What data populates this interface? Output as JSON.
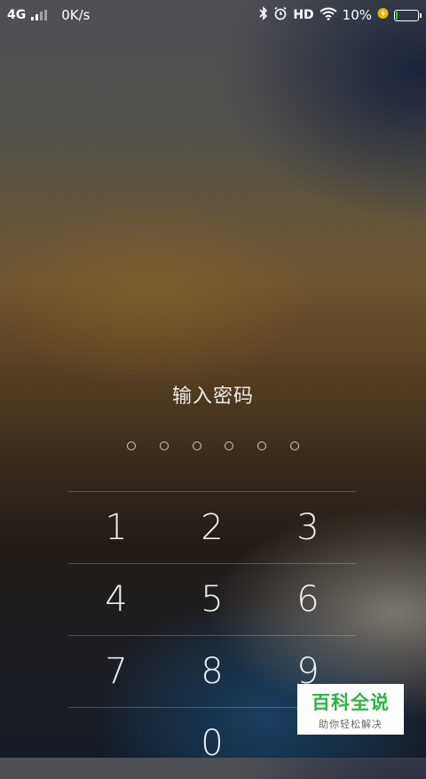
{
  "status_bar": {
    "network": "4G",
    "speed": "0K/s",
    "hd": "HD",
    "battery_percent": "10%",
    "battery_level": 0.1,
    "icons": [
      "signal-icon",
      "bluetooth-icon",
      "alarm-icon",
      "wifi-icon",
      "charging-icon",
      "battery-icon"
    ]
  },
  "lock_screen": {
    "prompt": "输入密码",
    "pin_length": 6,
    "keys": [
      [
        "1",
        "2",
        "3"
      ],
      [
        "4",
        "5",
        "6"
      ],
      [
        "7",
        "8",
        "9"
      ],
      [
        "",
        "0",
        ""
      ]
    ]
  },
  "watermark": {
    "title": "百科全说",
    "subtitle": "助你轻松解决",
    "color": "#2fb345"
  }
}
